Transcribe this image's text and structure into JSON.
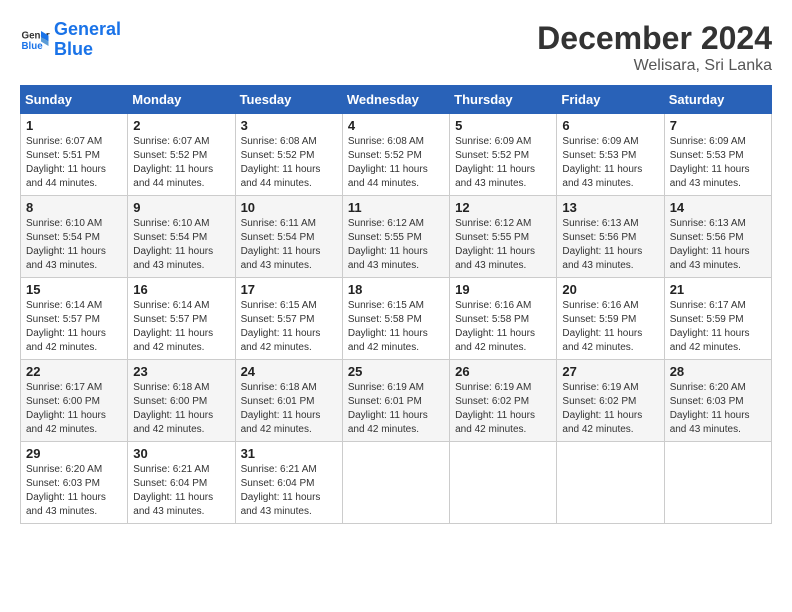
{
  "logo": {
    "line1": "General",
    "line2": "Blue"
  },
  "header": {
    "month": "December 2024",
    "location": "Welisara, Sri Lanka"
  },
  "weekdays": [
    "Sunday",
    "Monday",
    "Tuesday",
    "Wednesday",
    "Thursday",
    "Friday",
    "Saturday"
  ],
  "weeks": [
    [
      {
        "day": "1",
        "rise": "6:07 AM",
        "set": "5:51 PM",
        "daylight": "11 hours and 44 minutes."
      },
      {
        "day": "2",
        "rise": "6:07 AM",
        "set": "5:52 PM",
        "daylight": "11 hours and 44 minutes."
      },
      {
        "day": "3",
        "rise": "6:08 AM",
        "set": "5:52 PM",
        "daylight": "11 hours and 44 minutes."
      },
      {
        "day": "4",
        "rise": "6:08 AM",
        "set": "5:52 PM",
        "daylight": "11 hours and 44 minutes."
      },
      {
        "day": "5",
        "rise": "6:09 AM",
        "set": "5:52 PM",
        "daylight": "11 hours and 43 minutes."
      },
      {
        "day": "6",
        "rise": "6:09 AM",
        "set": "5:53 PM",
        "daylight": "11 hours and 43 minutes."
      },
      {
        "day": "7",
        "rise": "6:09 AM",
        "set": "5:53 PM",
        "daylight": "11 hours and 43 minutes."
      }
    ],
    [
      {
        "day": "8",
        "rise": "6:10 AM",
        "set": "5:54 PM",
        "daylight": "11 hours and 43 minutes."
      },
      {
        "day": "9",
        "rise": "6:10 AM",
        "set": "5:54 PM",
        "daylight": "11 hours and 43 minutes."
      },
      {
        "day": "10",
        "rise": "6:11 AM",
        "set": "5:54 PM",
        "daylight": "11 hours and 43 minutes."
      },
      {
        "day": "11",
        "rise": "6:12 AM",
        "set": "5:55 PM",
        "daylight": "11 hours and 43 minutes."
      },
      {
        "day": "12",
        "rise": "6:12 AM",
        "set": "5:55 PM",
        "daylight": "11 hours and 43 minutes."
      },
      {
        "day": "13",
        "rise": "6:13 AM",
        "set": "5:56 PM",
        "daylight": "11 hours and 43 minutes."
      },
      {
        "day": "14",
        "rise": "6:13 AM",
        "set": "5:56 PM",
        "daylight": "11 hours and 43 minutes."
      }
    ],
    [
      {
        "day": "15",
        "rise": "6:14 AM",
        "set": "5:57 PM",
        "daylight": "11 hours and 42 minutes."
      },
      {
        "day": "16",
        "rise": "6:14 AM",
        "set": "5:57 PM",
        "daylight": "11 hours and 42 minutes."
      },
      {
        "day": "17",
        "rise": "6:15 AM",
        "set": "5:57 PM",
        "daylight": "11 hours and 42 minutes."
      },
      {
        "day": "18",
        "rise": "6:15 AM",
        "set": "5:58 PM",
        "daylight": "11 hours and 42 minutes."
      },
      {
        "day": "19",
        "rise": "6:16 AM",
        "set": "5:58 PM",
        "daylight": "11 hours and 42 minutes."
      },
      {
        "day": "20",
        "rise": "6:16 AM",
        "set": "5:59 PM",
        "daylight": "11 hours and 42 minutes."
      },
      {
        "day": "21",
        "rise": "6:17 AM",
        "set": "5:59 PM",
        "daylight": "11 hours and 42 minutes."
      }
    ],
    [
      {
        "day": "22",
        "rise": "6:17 AM",
        "set": "6:00 PM",
        "daylight": "11 hours and 42 minutes."
      },
      {
        "day": "23",
        "rise": "6:18 AM",
        "set": "6:00 PM",
        "daylight": "11 hours and 42 minutes."
      },
      {
        "day": "24",
        "rise": "6:18 AM",
        "set": "6:01 PM",
        "daylight": "11 hours and 42 minutes."
      },
      {
        "day": "25",
        "rise": "6:19 AM",
        "set": "6:01 PM",
        "daylight": "11 hours and 42 minutes."
      },
      {
        "day": "26",
        "rise": "6:19 AM",
        "set": "6:02 PM",
        "daylight": "11 hours and 42 minutes."
      },
      {
        "day": "27",
        "rise": "6:19 AM",
        "set": "6:02 PM",
        "daylight": "11 hours and 42 minutes."
      },
      {
        "day": "28",
        "rise": "6:20 AM",
        "set": "6:03 PM",
        "daylight": "11 hours and 43 minutes."
      }
    ],
    [
      {
        "day": "29",
        "rise": "6:20 AM",
        "set": "6:03 PM",
        "daylight": "11 hours and 43 minutes."
      },
      {
        "day": "30",
        "rise": "6:21 AM",
        "set": "6:04 PM",
        "daylight": "11 hours and 43 minutes."
      },
      {
        "day": "31",
        "rise": "6:21 AM",
        "set": "6:04 PM",
        "daylight": "11 hours and 43 minutes."
      },
      null,
      null,
      null,
      null
    ]
  ]
}
